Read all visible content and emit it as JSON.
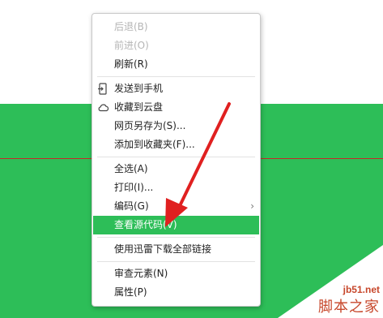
{
  "menu": {
    "items": [
      {
        "label": "后退(B)",
        "disabled": true
      },
      {
        "label": "前进(O)",
        "disabled": true
      },
      {
        "label": "刷新(R)"
      },
      {
        "separator": true
      },
      {
        "label": "发送到手机",
        "icon": "send-to-phone-icon"
      },
      {
        "label": "收藏到云盘",
        "icon": "cloud-icon"
      },
      {
        "label": "网页另存为(S)..."
      },
      {
        "label": "添加到收藏夹(F)..."
      },
      {
        "separator": true
      },
      {
        "label": "全选(A)"
      },
      {
        "label": "打印(I)..."
      },
      {
        "label": "编码(G)",
        "submenu": true
      },
      {
        "label": "查看源代码(V)",
        "highlight": true
      },
      {
        "separator": true
      },
      {
        "label": "使用迅雷下载全部链接"
      },
      {
        "separator": true
      },
      {
        "label": "审查元素(N)"
      },
      {
        "label": "属性(P)"
      }
    ]
  },
  "watermark": {
    "url": "jb51.net",
    "name": "脚本之家"
  },
  "colors": {
    "green": "#2dbe58",
    "red_line": "#c62828",
    "arrow": "#e02020"
  }
}
